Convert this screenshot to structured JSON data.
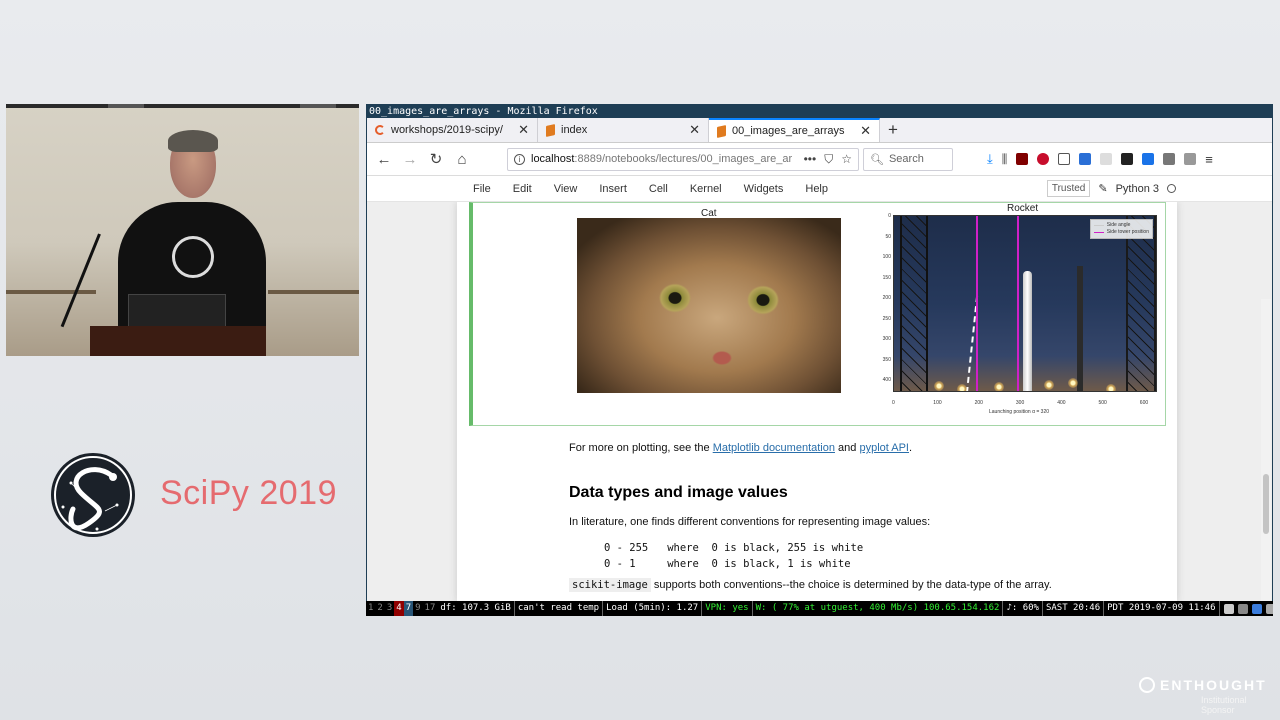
{
  "presentation": {
    "conference_title": "SciPy 2019",
    "sponsor_name": "ENTHOUGHT",
    "sponsor_subtitle": "Institutional Sponsor"
  },
  "window": {
    "title": "00_images_are_arrays - Mozilla Firefox"
  },
  "tabs": [
    {
      "label": "workshops/2019-scipy/",
      "icon": "loading-spinner-icon",
      "active": false
    },
    {
      "label": "index",
      "icon": "jupyter-notebook-icon",
      "active": false
    },
    {
      "label": "00_images_are_arrays",
      "icon": "jupyter-notebook-icon",
      "active": true
    }
  ],
  "navbar": {
    "url_host": "localhost",
    "url_rest": ":8889/notebooks/lectures/00_images_are_ar",
    "search_placeholder": "Search"
  },
  "jupyter_menu": {
    "items": [
      "File",
      "Edit",
      "View",
      "Insert",
      "Cell",
      "Kernel",
      "Widgets",
      "Help"
    ],
    "trusted_label": "Trusted",
    "kernel_name": "Python 3"
  },
  "output_cell": {
    "cat_title": "Cat",
    "rocket_title": "Rocket",
    "legend": [
      {
        "label": "Side angle",
        "color": "#ffffff"
      },
      {
        "label": "Side tower position",
        "color": "#d020c8"
      }
    ],
    "y_ticks": [
      "0",
      "50",
      "100",
      "150",
      "200",
      "250",
      "300",
      "350",
      "400"
    ],
    "x_ticks": [
      "0",
      "100",
      "200",
      "300",
      "400",
      "500",
      "600"
    ],
    "x_label": "Launching position α = 320"
  },
  "notebook": {
    "plot_text_before": "For more on plotting, see the ",
    "link_matplotlib": "Matplotlib documentation",
    "plot_text_and": " and ",
    "link_pyplot": "pyplot API",
    "plot_text_end": ".",
    "heading": "Data types and image values",
    "paragraph": "In literature, one finds different conventions for representing image values:",
    "code_lines": [
      "0 - 255   where  0 is black, 255 is white",
      "0 - 1     where  0 is black, 1 is white"
    ],
    "inline_code": "scikit-image",
    "last_text": " supports both conventions--the choice is determined by the data-type of the array."
  },
  "statusbar": {
    "workspaces": [
      {
        "label": "1",
        "state": "normal"
      },
      {
        "label": "2",
        "state": "normal"
      },
      {
        "label": "3",
        "state": "normal"
      },
      {
        "label": "4",
        "state": "urgent"
      },
      {
        "label": "7",
        "state": "focused"
      },
      {
        "label": "9",
        "state": "normal"
      },
      {
        "label": "17",
        "state": "normal"
      }
    ],
    "items": [
      {
        "text": "df: 107.3 GiB",
        "good": false
      },
      {
        "text": "can't read temp",
        "good": false
      },
      {
        "text": "Load (5min): 1.27",
        "good": false
      },
      {
        "text": "VPN: yes",
        "good": true
      },
      {
        "text": "W: ( 77% at utguest, 400 Mb/s) 100.65.154.162",
        "good": true
      },
      {
        "text": "♪: 60%",
        "good": false
      },
      {
        "text": "SAST 20:46",
        "good": false
      },
      {
        "text": "PDT 2019-07-09 11:46",
        "good": false
      }
    ]
  }
}
